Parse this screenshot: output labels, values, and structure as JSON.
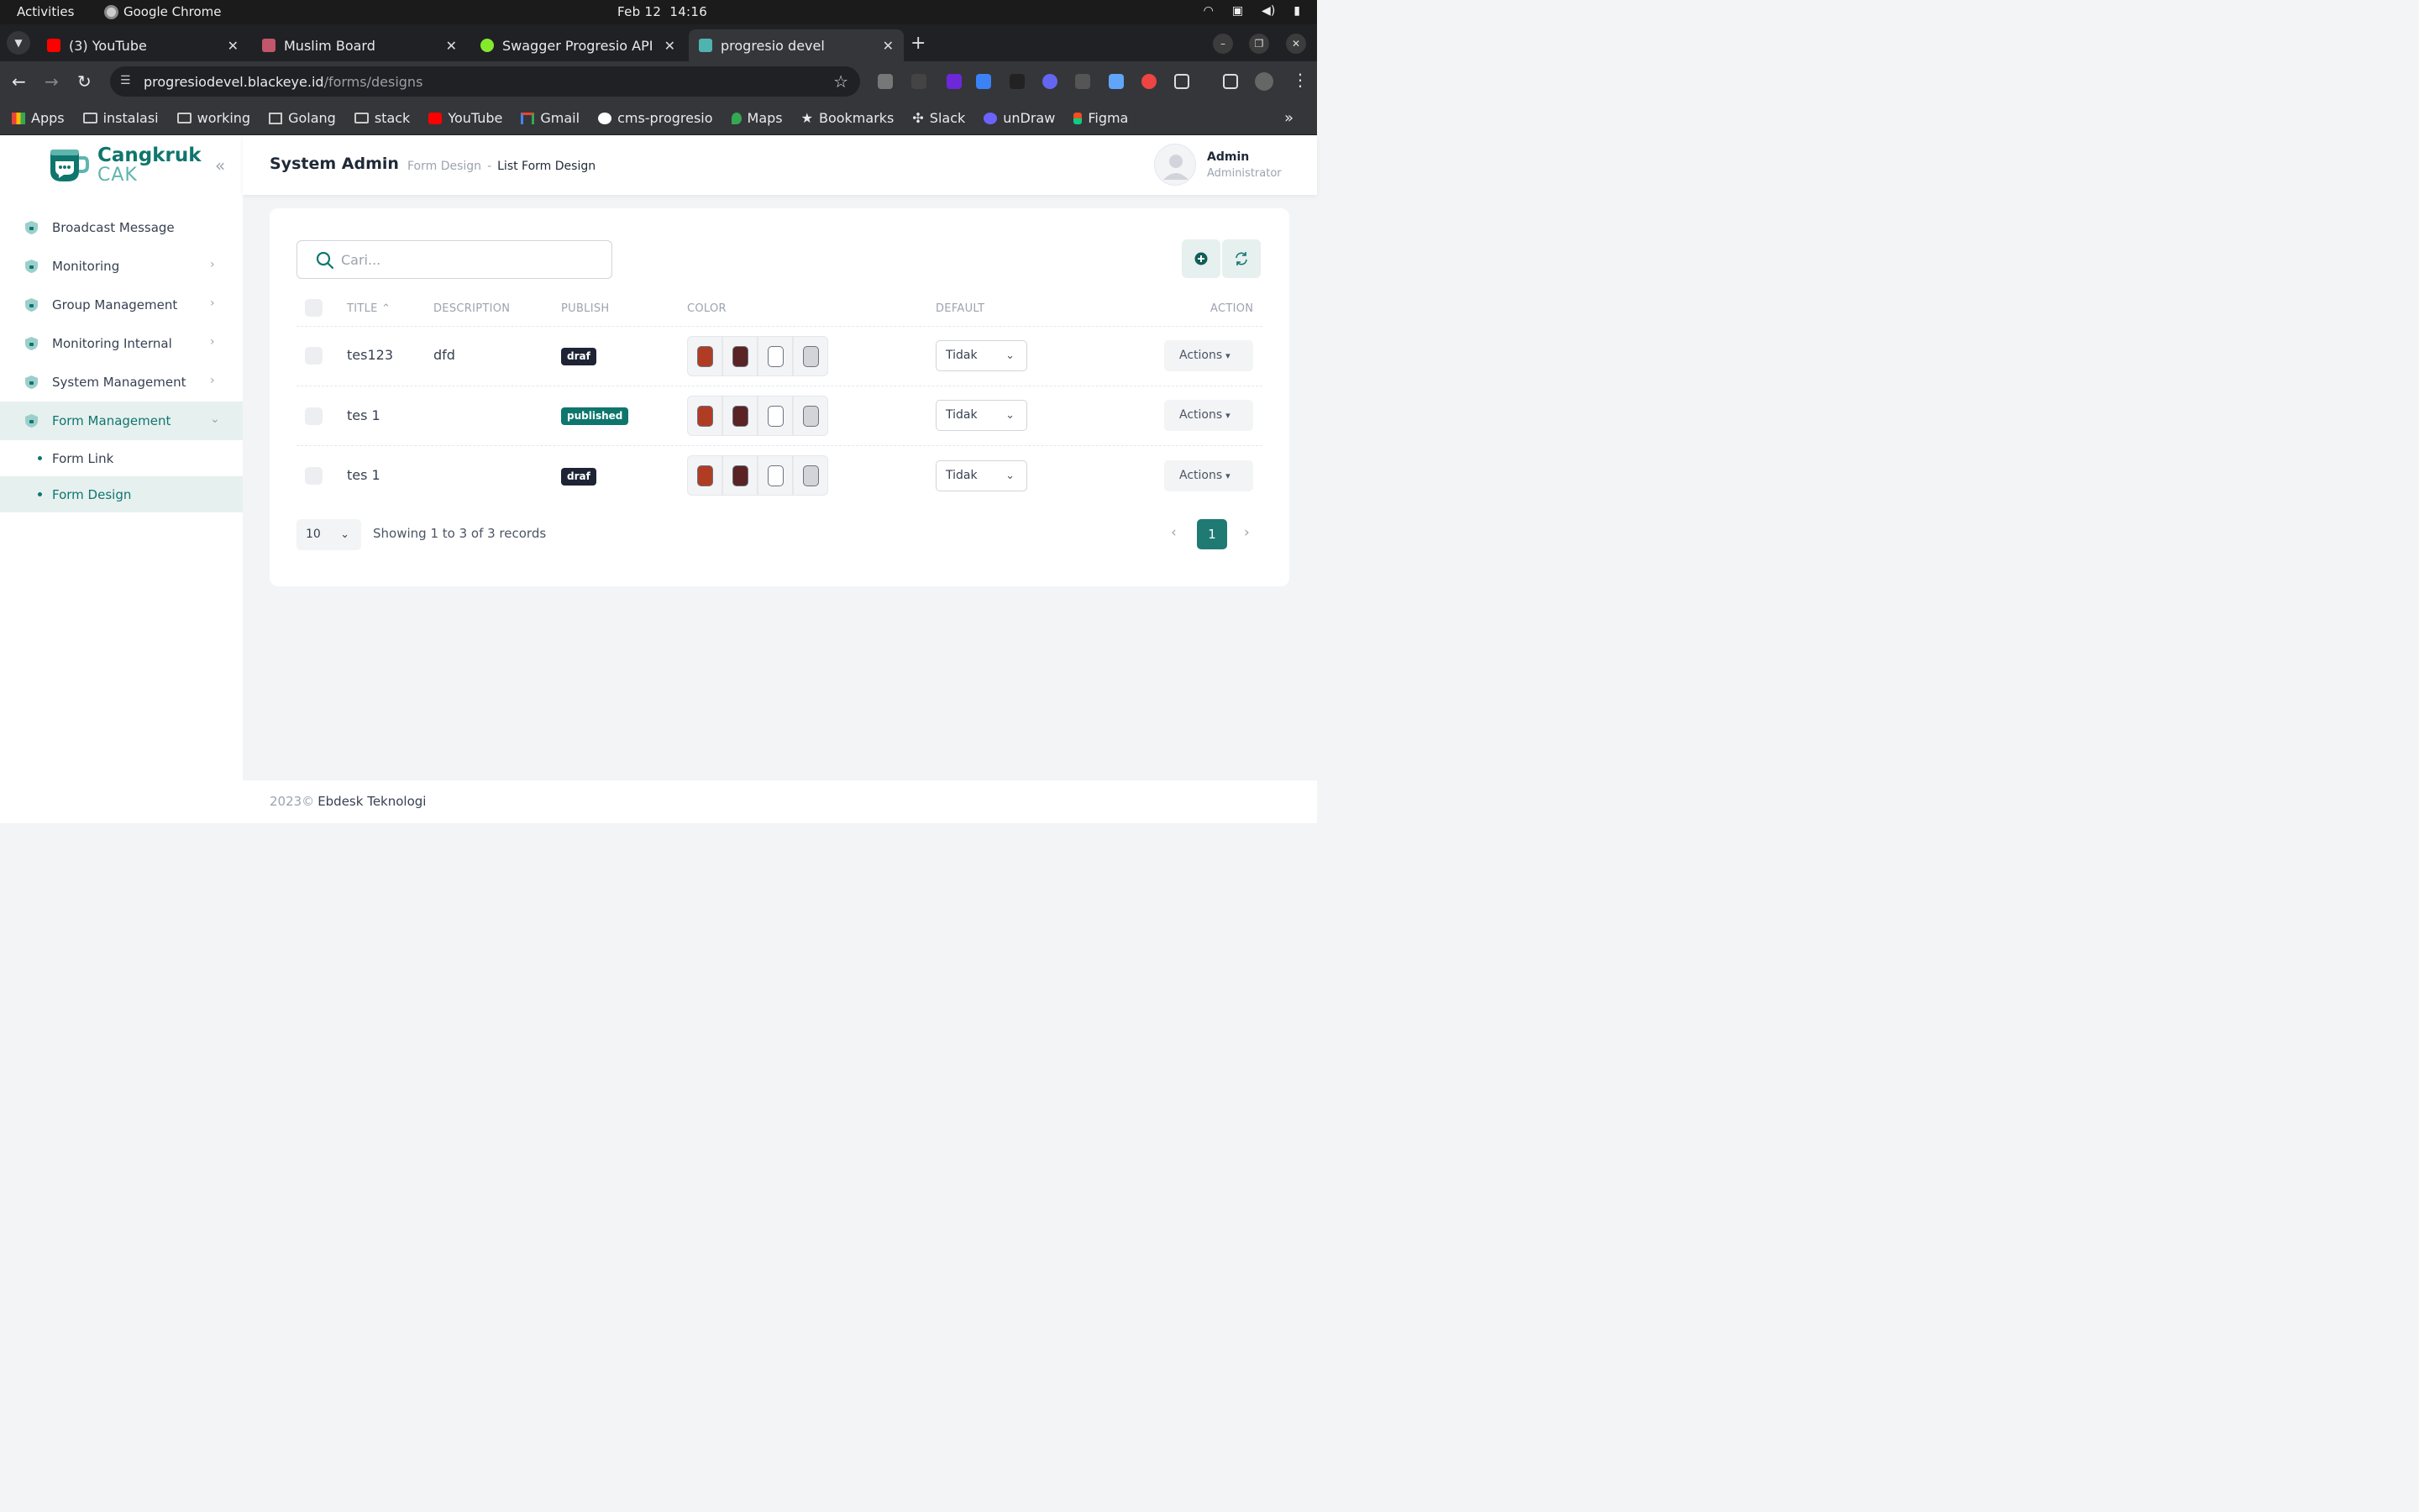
{
  "os": {
    "activities": "Activities",
    "app_name": "Google Chrome",
    "date": "Feb 12",
    "time": "14:16"
  },
  "browser": {
    "tabs": [
      {
        "title": "(3) YouTube",
        "favicon_color": "#ff0000"
      },
      {
        "title": "Muslim Board",
        "favicon_color": "#c2566b"
      },
      {
        "title": "Swagger Progresio API",
        "favicon_color": "#85ea2d"
      },
      {
        "title": "progresio devel",
        "favicon_color": "#4fb3b0"
      }
    ],
    "url_host": "progresiodevel.blackeye.id",
    "url_path": "/forms/designs",
    "bookmarks": [
      {
        "label": "Apps",
        "icon": "apps-grid-icon"
      },
      {
        "label": "instalasi",
        "icon": "folder-icon"
      },
      {
        "label": "working",
        "icon": "folder-icon"
      },
      {
        "label": "Golang",
        "icon": "book-icon"
      },
      {
        "label": "stack",
        "icon": "folder-icon"
      },
      {
        "label": "YouTube",
        "icon": "youtube-icon"
      },
      {
        "label": "Gmail",
        "icon": "gmail-icon"
      },
      {
        "label": "cms-progresio",
        "icon": "shield-icon"
      },
      {
        "label": "Maps",
        "icon": "maps-icon"
      },
      {
        "label": "Bookmarks",
        "icon": "star-icon"
      },
      {
        "label": "Slack",
        "icon": "slack-icon"
      },
      {
        "label": "unDraw",
        "icon": "undraw-icon"
      },
      {
        "label": "Figma",
        "icon": "figma-icon"
      }
    ]
  },
  "app": {
    "brand_line1": "Cangkruk",
    "brand_line2": "CAK",
    "sidebar": {
      "items": [
        {
          "label": "Broadcast Message",
          "has_children": false
        },
        {
          "label": "Monitoring",
          "has_children": true
        },
        {
          "label": "Group Management",
          "has_children": true
        },
        {
          "label": "Monitoring Internal",
          "has_children": true
        },
        {
          "label": "System Management",
          "has_children": true
        },
        {
          "label": "Form Management",
          "has_children": true,
          "expanded": true
        }
      ],
      "subitems": [
        {
          "label": "Form Link"
        },
        {
          "label": "Form Design"
        }
      ]
    },
    "header": {
      "title": "System Admin",
      "breadcrumb_parent": "Form Design",
      "breadcrumb_sep": "-",
      "breadcrumb_current": "List Form Design",
      "user_name": "Admin",
      "user_role": "Administrator"
    },
    "search": {
      "placeholder": "Cari..."
    },
    "table": {
      "columns": {
        "title": "TITLE",
        "description": "DESCRIPTION",
        "publish": "PUBLISH",
        "color": "COLOR",
        "default": "DEFAULT",
        "action": "ACTION"
      },
      "rows": [
        {
          "title": "tes123",
          "description": "dfd",
          "publish": "draf",
          "colors": [
            "#b03c24",
            "#5a2424",
            "#ffffff",
            "#d4d4d8"
          ],
          "default": "Tidak",
          "action": "Actions"
        },
        {
          "title": "tes 1",
          "description": "",
          "publish": "published",
          "colors": [
            "#b03c24",
            "#5a2424",
            "#ffffff",
            "#d4d4d8"
          ],
          "default": "Tidak",
          "action": "Actions"
        },
        {
          "title": "tes 1",
          "description": "",
          "publish": "draf",
          "colors": [
            "#b03c24",
            "#5a2424",
            "#ffffff",
            "#d4d4d8"
          ],
          "default": "Tidak",
          "action": "Actions"
        }
      ]
    },
    "pagination": {
      "page_size": "10",
      "info": "Showing 1 to 3 of 3 records",
      "current_page": "1"
    },
    "footer": {
      "year": "2023©",
      "company": "Ebdesk Teknologi"
    },
    "colors": {
      "primary": "#0f766e",
      "primary_soft": "#e6f0ef"
    }
  }
}
